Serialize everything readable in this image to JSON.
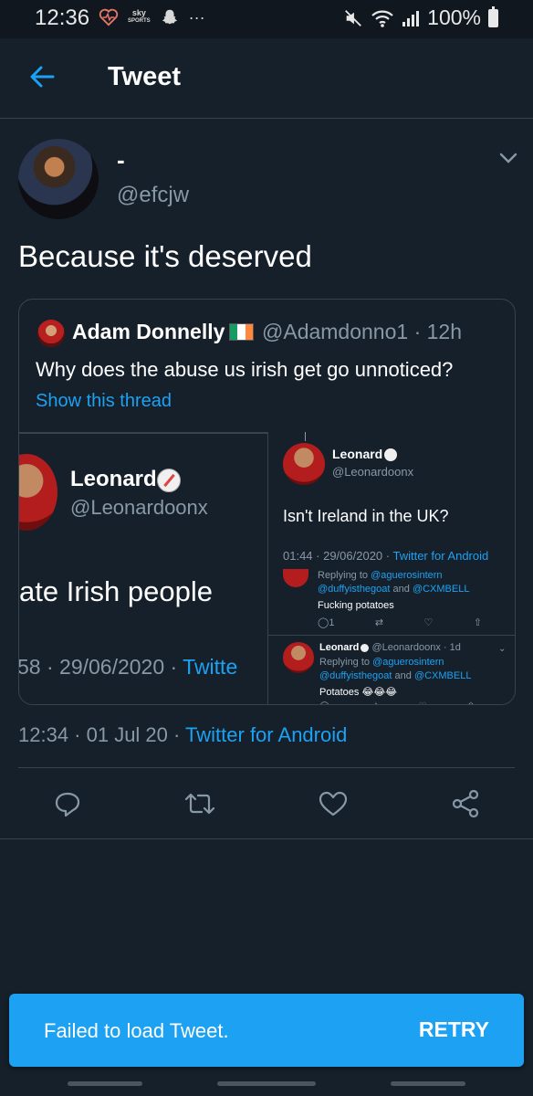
{
  "status_bar": {
    "time": "12:36",
    "battery": "100%",
    "notification_icons": [
      "heart-rate-icon",
      "sky-sports-icon",
      "snapchat-icon",
      "more-dots-icon"
    ],
    "sky_line1": "sky",
    "sky_line2": "SPORTS",
    "dots": "···",
    "right_icons": [
      "mute-icon",
      "wifi-icon",
      "signal-icon",
      "battery-icon"
    ]
  },
  "header": {
    "title": "Tweet"
  },
  "tweet": {
    "display_name": "-",
    "handle": "@efcjw",
    "text": "Because it's deserved",
    "timestamp": "12:34 · 01 Jul 20 · ",
    "source": "Twitter for Android"
  },
  "quote": {
    "name": "Adam Donnelly",
    "flag": "Ireland",
    "handle_time": "@Adamdonno1 · 12h",
    "text": "Why does the abuse us irish get go unnoticed?",
    "thread_link": "Show this thread",
    "image": {
      "left": {
        "name": "Leonard",
        "handle": "@Leonardoonx",
        "text": "ate Irish people",
        "meta_prefix": "58 · 29/06/2020 · ",
        "meta_link": "Twitte"
      },
      "right": {
        "name": "Leonard",
        "handle": "@Leonardoonx",
        "text": "Isn't Ireland in the UK?",
        "meta_prefix": "01:44 · 29/06/2020 · ",
        "meta_link": "Twitter for Android",
        "reply1": {
          "replying_prefix": "Replying to ",
          "replying_link1": "@aguerosintern",
          "replying_link2": "@duffyisthegoat",
          "replying_and": " and ",
          "replying_link3": "@CXMBELL",
          "text": "Fucking potatoes",
          "reply_count": "1"
        },
        "reply2": {
          "name": "Leonard",
          "handle_time": "@Leonardoonx · 1d",
          "replying_prefix": "Replying to ",
          "replying_link1": "@aguerosintern",
          "replying_link2": "@duffyisthegoat",
          "replying_and": " and ",
          "replying_link3": "@CXMBELL",
          "text": "Potatoes 😂😂😂"
        }
      }
    }
  },
  "actions": [
    "reply-icon",
    "retweet-icon",
    "like-icon",
    "share-icon"
  ],
  "toast": {
    "message": "Failed to load Tweet.",
    "action": "RETRY"
  },
  "colors": {
    "background": "#15202b",
    "accent": "#1da1f2",
    "secondary_text": "#8899a6",
    "border": "#38444d"
  }
}
